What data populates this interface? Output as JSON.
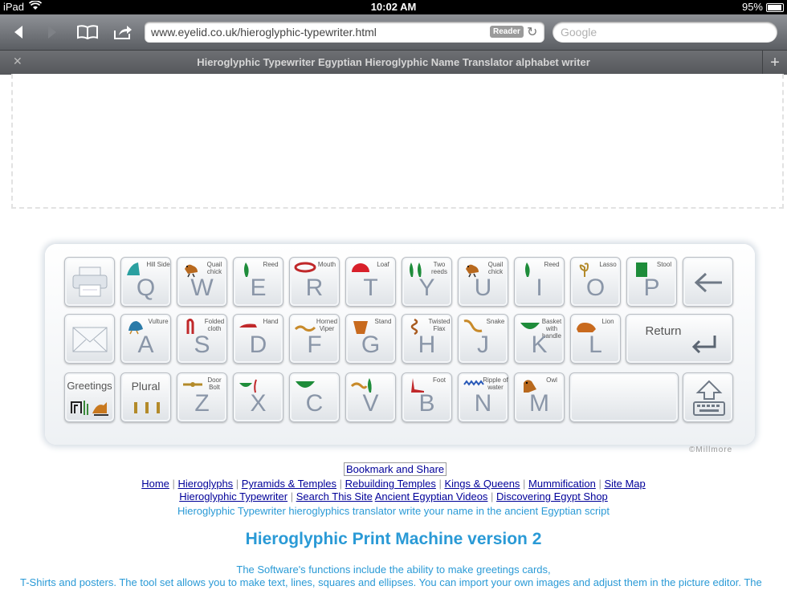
{
  "status": {
    "device": "iPad",
    "time": "10:02 AM",
    "battery": "95%"
  },
  "browser": {
    "url": "www.eyelid.co.uk/hieroglyphic-typewriter.html",
    "reader_label": "Reader",
    "search_placeholder": "Google",
    "tab_title": "Hieroglyphic Typewriter Egyptian Hieroglyphic Name Translator alphabet writer"
  },
  "keyboard": {
    "row1": [
      {
        "letter": "Q",
        "sub": "Hill Side",
        "glyph": "hill"
      },
      {
        "letter": "W",
        "sub": "Quail chick",
        "glyph": "chick"
      },
      {
        "letter": "E",
        "sub": "Reed",
        "glyph": "reed"
      },
      {
        "letter": "R",
        "sub": "Mouth",
        "glyph": "mouth"
      },
      {
        "letter": "T",
        "sub": "Loaf",
        "glyph": "loaf"
      },
      {
        "letter": "Y",
        "sub": "Two reeds",
        "glyph": "tworeeds"
      },
      {
        "letter": "U",
        "sub": "Quail chick",
        "glyph": "chick"
      },
      {
        "letter": "I",
        "sub": "Reed",
        "glyph": "reed"
      },
      {
        "letter": "O",
        "sub": "Lasso",
        "glyph": "lasso"
      },
      {
        "letter": "P",
        "sub": "Stool",
        "glyph": "stool"
      }
    ],
    "row2": [
      {
        "letter": "A",
        "sub": "Vulture",
        "glyph": "vulture"
      },
      {
        "letter": "S",
        "sub": "Folded cloth",
        "glyph": "cloth"
      },
      {
        "letter": "D",
        "sub": "Hand",
        "glyph": "hand"
      },
      {
        "letter": "F",
        "sub": "Horned Viper",
        "glyph": "viper"
      },
      {
        "letter": "G",
        "sub": "Stand",
        "glyph": "stand"
      },
      {
        "letter": "H",
        "sub": "Twisted Flax",
        "glyph": "flax"
      },
      {
        "letter": "J",
        "sub": "Snake",
        "glyph": "snake"
      },
      {
        "letter": "K",
        "sub": "Basket with handle",
        "glyph": "basket"
      },
      {
        "letter": "L",
        "sub": "Lion",
        "glyph": "lion"
      }
    ],
    "row3": [
      {
        "letter": "Z",
        "sub": "Door Bolt",
        "glyph": "bolt"
      },
      {
        "letter": "X",
        "sub": "",
        "glyph": "basketreed"
      },
      {
        "letter": "C",
        "sub": "",
        "glyph": "basket"
      },
      {
        "letter": "V",
        "sub": "",
        "glyph": "viperreed"
      },
      {
        "letter": "B",
        "sub": "Foot",
        "glyph": "foot"
      },
      {
        "letter": "N",
        "sub": "Ripple of water",
        "glyph": "water"
      },
      {
        "letter": "M",
        "sub": "Owl",
        "glyph": "owl"
      }
    ],
    "return_label": "Return",
    "greetings_label": "Greetings",
    "plural_label": "Plural",
    "credit": "©Millmore"
  },
  "bookmark": "Bookmark and Share",
  "nav1": [
    "Home",
    "Hieroglyphs",
    "Pyramids & Temples",
    "Rebuilding Temples",
    "Kings & Queens",
    "Mummification",
    "Site Map"
  ],
  "nav2": [
    "Hieroglyphic Typewriter",
    "Search This Site",
    "Ancient Egyptian Videos",
    "Discovering Egypt Shop"
  ],
  "tagline": "Hieroglyphic Typewriter hieroglyphics translator write your name in the ancient Egyptian script",
  "heading": "Hieroglyphic Print Machine version 2",
  "para1": "The Software's functions include the ability to make greetings cards,",
  "para2": "T-Shirts and posters. The tool set allows you to make text, lines, squares and ellipses. You can import your own images and adjust them in the picture editor. The",
  "colors": {
    "accent": "#2a9ad6",
    "link": "#000099",
    "key_letter": "#8a96a8"
  }
}
